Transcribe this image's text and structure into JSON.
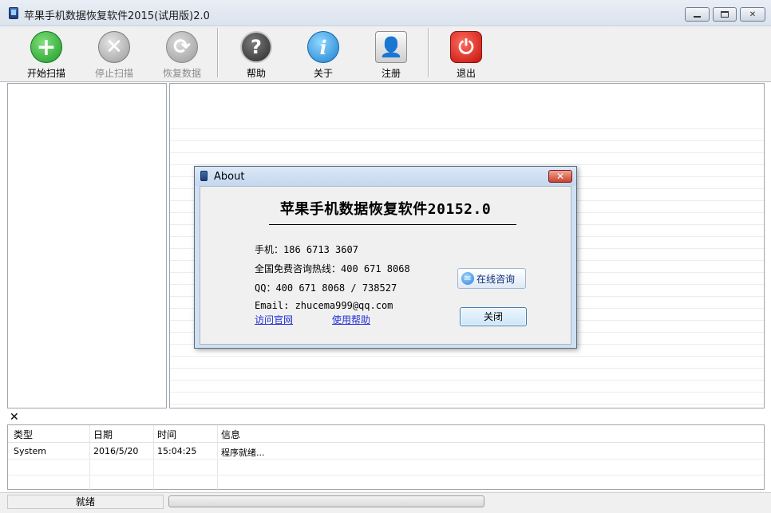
{
  "window": {
    "title": "苹果手机数据恢复软件2015(试用版)2.0"
  },
  "toolbar": {
    "items": [
      {
        "label": "开始扫描",
        "icon": "plus-icon",
        "enabled": true
      },
      {
        "label": "停止扫描",
        "icon": "stop-icon",
        "enabled": false
      },
      {
        "label": "恢复数据",
        "icon": "sync-icon",
        "enabled": false
      },
      {
        "label": "帮助",
        "icon": "help-icon",
        "enabled": true
      },
      {
        "label": "关于",
        "icon": "info-icon",
        "enabled": true
      },
      {
        "label": "注册",
        "icon": "user-icon",
        "enabled": true
      },
      {
        "label": "退出",
        "icon": "power-icon",
        "enabled": true
      }
    ]
  },
  "log": {
    "close_glyph": "✕",
    "columns": [
      "类型",
      "日期",
      "时间",
      "信息"
    ],
    "rows": [
      {
        "type": "System",
        "date": "2016/5/20",
        "time": "15:04:25",
        "message": "程序就绪..."
      }
    ]
  },
  "status": {
    "text": "就绪"
  },
  "about": {
    "title": "About",
    "heading": "苹果手机数据恢复软件20152.0",
    "phone": "手机：186 6713 3607",
    "hotline": "全国免费咨询热线：400 671 8068",
    "qq": "QQ：400 671 8068 / 738527",
    "email": "Email: zhucema999@qq.com",
    "link_website": "访问官网",
    "link_help": "使用帮助",
    "consult_button": "在线咨询",
    "close_button": "关闭"
  },
  "colors": {
    "accent_blue": "#1f2fd6",
    "exit_red": "#c4140c",
    "start_green": "#1d9a2a"
  }
}
